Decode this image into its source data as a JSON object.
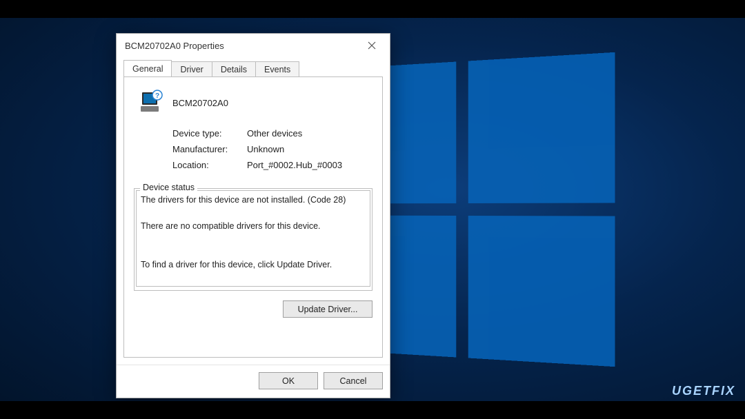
{
  "window": {
    "title": "BCM20702A0 Properties",
    "close_tooltip": "Close"
  },
  "tabs": [
    {
      "label": "General",
      "active": true
    },
    {
      "label": "Driver",
      "active": false
    },
    {
      "label": "Details",
      "active": false
    },
    {
      "label": "Events",
      "active": false
    }
  ],
  "device": {
    "name": "BCM20702A0",
    "icon_semantic": "unknown-device-icon",
    "props": {
      "device_type_label": "Device type:",
      "device_type_value": "Other devices",
      "manufacturer_label": "Manufacturer:",
      "manufacturer_value": "Unknown",
      "location_label": "Location:",
      "location_value": "Port_#0002.Hub_#0003"
    }
  },
  "status": {
    "group_label": "Device status",
    "text": "The drivers for this device are not installed. (Code 28)\n\nThere are no compatible drivers for this device.\n\n\nTo find a driver for this device, click Update Driver."
  },
  "buttons": {
    "update_driver": "Update Driver...",
    "ok": "OK",
    "cancel": "Cancel"
  },
  "watermark": "UGETFIX",
  "colors": {
    "desktop_gradient_inner": "#0c3d7a",
    "desktop_gradient_outer": "#021329",
    "windows_logo": "#0561b5",
    "dialog_bg": "#ffffff",
    "dialog_border": "#ababab",
    "button_bg": "#e9e9e9"
  }
}
